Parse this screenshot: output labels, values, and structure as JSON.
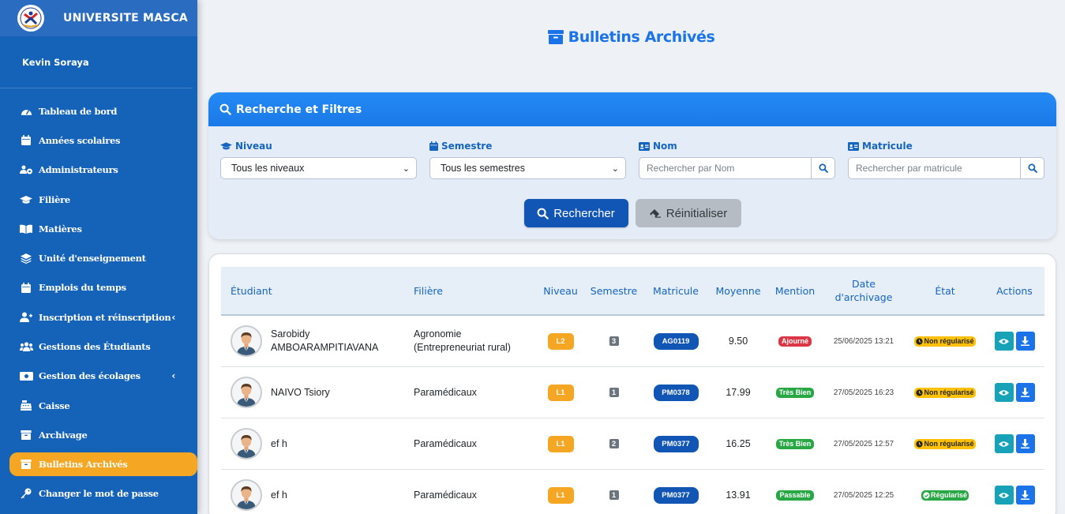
{
  "app": {
    "title": "UNIVERSITE MASCA",
    "user": "Kevin Soraya"
  },
  "sidebar": {
    "items": [
      {
        "label": "Tableau de bord",
        "icon": "gauge-icon",
        "chevron": false
      },
      {
        "label": "Années scolaires",
        "icon": "calendar-icon",
        "chevron": false
      },
      {
        "label": "Administrateurs",
        "icon": "users-gear-icon",
        "chevron": false
      },
      {
        "label": "Filière",
        "icon": "graduation-cap-icon",
        "chevron": false
      },
      {
        "label": "Matières",
        "icon": "book-open-icon",
        "chevron": false
      },
      {
        "label": "Unité d'enseignement",
        "icon": "layers-icon",
        "chevron": false
      },
      {
        "label": "Emplois du temps",
        "icon": "calendar-icon",
        "chevron": false
      },
      {
        "label": "Inscription et réinscription",
        "icon": "user-plus-icon",
        "chevron": true
      },
      {
        "label": "Gestions des Étudiants",
        "icon": "users-icon",
        "chevron": false
      },
      {
        "label": "Gestion des écolages",
        "icon": "money-icon",
        "chevron": true
      },
      {
        "label": "Caisse",
        "icon": "cash-register-icon",
        "chevron": false
      },
      {
        "label": "Archivage",
        "icon": "archive-icon",
        "chevron": false
      },
      {
        "label": "Bulletins Archivés",
        "icon": "archive-icon",
        "chevron": false,
        "active": true
      },
      {
        "label": "Changer le mot de passe",
        "icon": "key-icon",
        "chevron": false
      }
    ],
    "active_color": "#f5a623",
    "bg_color": "#1563b8"
  },
  "page": {
    "title": "Bulletins Archivés"
  },
  "filters": {
    "header": "Recherche et Filtres",
    "niveau": {
      "label": "Niveau",
      "value": "Tous les niveaux"
    },
    "semestre": {
      "label": "Semestre",
      "value": "Tous les semestres"
    },
    "nom": {
      "label": "Nom",
      "placeholder": "Rechercher par Nom"
    },
    "matricule": {
      "label": "Matricule",
      "placeholder": "Rechercher par matricule"
    },
    "search_button": "Rechercher",
    "reset_button": "Réinitialiser"
  },
  "table": {
    "headers": [
      "Étudiant",
      "Filière",
      "Niveau",
      "Semestre",
      "Matricule",
      "Moyenne",
      "Mention",
      "Date d'archivage",
      "État",
      "Actions"
    ],
    "header_date_line1": "Date",
    "header_date_line2": "d'archivage",
    "rows": [
      {
        "name_line1": "Sarobidy",
        "name_line2": "AMBOARAMPITIAVANA",
        "filiere_line1": "Agronomie",
        "filiere_line2": "(Entrepreneuriat rural)",
        "niveau": "L2",
        "semestre": "3",
        "matricule": "AG0119",
        "moyenne": "9.50",
        "mention": "Ajourné",
        "mention_color": "#dc3545",
        "date": "25/06/2025 13:21",
        "etat": "Non régularisé",
        "etat_type": "warning"
      },
      {
        "name_line1": "NAIVO Tsiory",
        "name_line2": "",
        "filiere_line1": "Paramédicaux",
        "filiere_line2": "",
        "niveau": "L1",
        "semestre": "1",
        "matricule": "PM0378",
        "moyenne": "17.99",
        "mention": "Très Bien",
        "mention_color": "#28a745",
        "date": "27/05/2025 16:23",
        "etat": "Non régularisé",
        "etat_type": "warning"
      },
      {
        "name_line1": "ef h",
        "name_line2": "",
        "filiere_line1": "Paramédicaux",
        "filiere_line2": "",
        "niveau": "L1",
        "semestre": "2",
        "matricule": "PM0377",
        "moyenne": "16.25",
        "mention": "Très Bien",
        "mention_color": "#28a745",
        "date": "27/05/2025 12:57",
        "etat": "Non régularisé",
        "etat_type": "warning"
      },
      {
        "name_line1": "ef h",
        "name_line2": "",
        "filiere_line1": "Paramédicaux",
        "filiere_line2": "",
        "niveau": "L1",
        "semestre": "1",
        "matricule": "PM0377",
        "moyenne": "13.91",
        "mention": "Passable",
        "mention_color": "#28a745",
        "date": "27/05/2025 12:25",
        "etat": "Régularisé",
        "etat_type": "success"
      }
    ]
  },
  "colors": {
    "primary": "#1a73e8",
    "info": "#17a2b8",
    "warning": "#ffc107",
    "success": "#28a745",
    "danger": "#dc3545"
  }
}
